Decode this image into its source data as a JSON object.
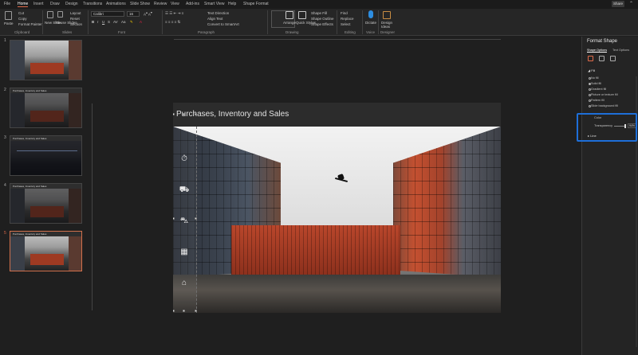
{
  "menu": {
    "tabs": [
      "File",
      "Home",
      "Insert",
      "Draw",
      "Design",
      "Transitions",
      "Animations",
      "Slide Show",
      "Review",
      "View",
      "Add-ins",
      "Smart View",
      "Help",
      "Shape Format"
    ],
    "active_tab": "Home",
    "share_label": "Share"
  },
  "ribbon": {
    "clipboard": {
      "paste": "Paste",
      "cut": "Cut",
      "copy": "Copy",
      "format_painter": "Format Painter",
      "label": "Clipboard"
    },
    "slides": {
      "new_slide": "New Slide",
      "reuse_slides": "Reuse Slides",
      "layout": "Layout",
      "reset": "Reset",
      "section": "Section",
      "label": "Slides"
    },
    "font": {
      "name": "Calibri",
      "size": "16",
      "label": "Font"
    },
    "paragraph": {
      "text_direction": "Text Direction",
      "align_text": "Align Text",
      "smartart": "Convert to SmartArt",
      "label": "Paragraph"
    },
    "drawing": {
      "arrange": "Arrange",
      "quick_styles": "Quick Styles",
      "shape_fill": "Shape Fill",
      "shape_outline": "Shape Outline",
      "shape_effects": "Shape Effects",
      "label": "Drawing"
    },
    "editing": {
      "find": "Find",
      "replace": "Replace",
      "select": "Select",
      "label": "Editing"
    },
    "voice": {
      "dictate": "Dictate",
      "label": "Voice"
    },
    "designer": {
      "design_ideas": "Design Ideas",
      "label": "Designer"
    }
  },
  "thumbnails": [
    {
      "num": "1",
      "title": ""
    },
    {
      "num": "2",
      "title": "Purchases, Inventory and Sales"
    },
    {
      "num": "3",
      "title": "Purchases, Inventory and Sales"
    },
    {
      "num": "4",
      "title": "Purchases, Inventory and Sales"
    },
    {
      "num": "5",
      "title": "Purchases, Inventory and Sales"
    }
  ],
  "slide": {
    "title": "Purchases, Inventory and Sales"
  },
  "side_icons": [
    "stopwatch-icon",
    "forklift-icon",
    "truck-icon",
    "pallet-icon",
    "warehouse-icon"
  ],
  "pane": {
    "title": "Format Shape",
    "tab_shape_options": "Shape Options",
    "tab_text_options": "Text Options",
    "fill_section": "Fill",
    "fill_options": [
      "No fill",
      "Solid fill",
      "Gradient fill",
      "Picture or texture fill",
      "Pattern fill",
      "Slide background fill"
    ],
    "selected_fill": "Solid fill",
    "color_label": "Color",
    "transparency_label": "Transparency",
    "transparency_value": "94%",
    "transparency_fraction": 0.94,
    "line_section": "Line"
  },
  "colors": {
    "accent": "#e06b4a",
    "highlight": "#1e6fd9",
    "background": "#1f1f1f"
  }
}
